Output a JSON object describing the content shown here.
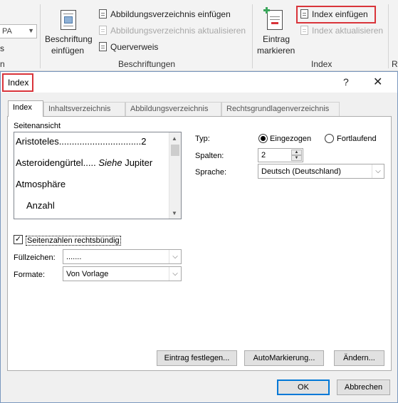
{
  "ribbon": {
    "style_combo_value": "PA",
    "left_stub_text": "s",
    "left_stub_label": "n",
    "caption_group": {
      "insert_caption_line1": "Beschriftung",
      "insert_caption_line2": "einfügen",
      "insert_table_of_figures": "Abbildungsverzeichnis einfügen",
      "update_table": "Abbildungsverzeichnis aktualisieren",
      "cross_reference": "Querverweis",
      "group_label": "Beschriftungen"
    },
    "index_group": {
      "mark_entry_line1": "Eintrag",
      "mark_entry_line2": "markieren",
      "insert_index": "Index einfügen",
      "update_index": "Index aktualisieren",
      "group_label": "Index"
    },
    "right_stub_label": "R"
  },
  "dialog": {
    "title": "Index",
    "help_glyph": "?",
    "close_glyph": "✕",
    "tabs": [
      {
        "label": "Index",
        "active": true
      },
      {
        "label": "Inhaltsverzeichnis",
        "active": false
      },
      {
        "label": "Abbildungsverzeichnis",
        "active": false
      },
      {
        "label": "Rechtsgrundlagenverzeichnis",
        "active": false
      }
    ],
    "preview": {
      "label": "Seitenansicht",
      "entries": [
        {
          "text": "Aristoteles................................2"
        },
        {
          "text_before": "Asteroidengürtel..... ",
          "text_italic": "Siehe",
          "text_after": " Jupiter"
        },
        {
          "text": "Atmosphäre"
        },
        {
          "text": "Anzahl"
        }
      ]
    },
    "right_align_label": "Seitenzahlen rechtsbündig",
    "right_align_checked": true,
    "tab_leader": {
      "label": "Füllzeichen:",
      "value": "......."
    },
    "formats": {
      "label": "Formate:",
      "value": "Von Vorlage"
    },
    "type": {
      "label": "Typ:",
      "options": [
        {
          "label": "Eingezogen",
          "selected": true
        },
        {
          "label": "Fortlaufend",
          "selected": false
        }
      ]
    },
    "columns": {
      "label": "Spalten:",
      "value": "2"
    },
    "language": {
      "label": "Sprache:",
      "value": "Deutsch (Deutschland)"
    },
    "buttons": {
      "mark_entry": "Eintrag festlegen...",
      "automark": "AutoMarkierung...",
      "modify": "Ändern...",
      "ok": "OK",
      "cancel": "Abbrechen"
    }
  },
  "colors": {
    "highlight_border": "#d9343a",
    "default_button_border": "#0078d7",
    "dialog_border": "#7a98bf",
    "ribbon_background": "#f3f3f3"
  },
  "icons": [
    "insert-caption-icon",
    "mark-entry-icon",
    "document-icon",
    "help-icon",
    "close-icon",
    "chevron-down-icon",
    "scroll-up-icon",
    "scroll-down-icon",
    "spin-up-icon",
    "spin-down-icon"
  ]
}
